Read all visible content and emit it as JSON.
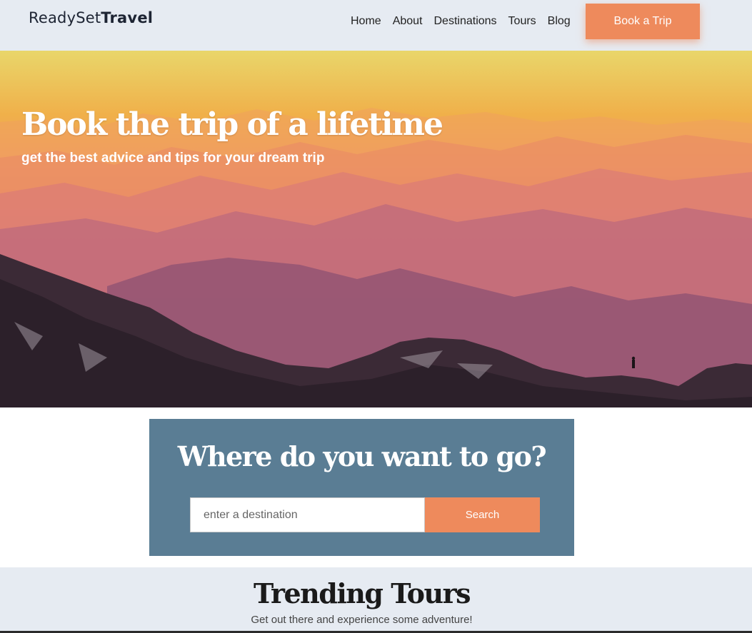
{
  "header": {
    "logo_regular": "ReadySet",
    "logo_bold": "Travel",
    "nav": [
      "Home",
      "About",
      "Destinations",
      "Tours",
      "Blog"
    ],
    "cta_label": "Book a Trip"
  },
  "hero": {
    "title": "Book the trip of a lifetime",
    "subtitle": "get the best advice and tips for your dream trip"
  },
  "search": {
    "title": "Where do you want to go?",
    "placeholder": "enter a destination",
    "button_label": "Search"
  },
  "trending": {
    "title": "Trending Tours",
    "subtitle": "Get out there and experience some adventure!"
  },
  "colors": {
    "accent": "#ee8a5c",
    "search_panel": "#5a7d94",
    "header_bg": "#e6ebf2"
  }
}
